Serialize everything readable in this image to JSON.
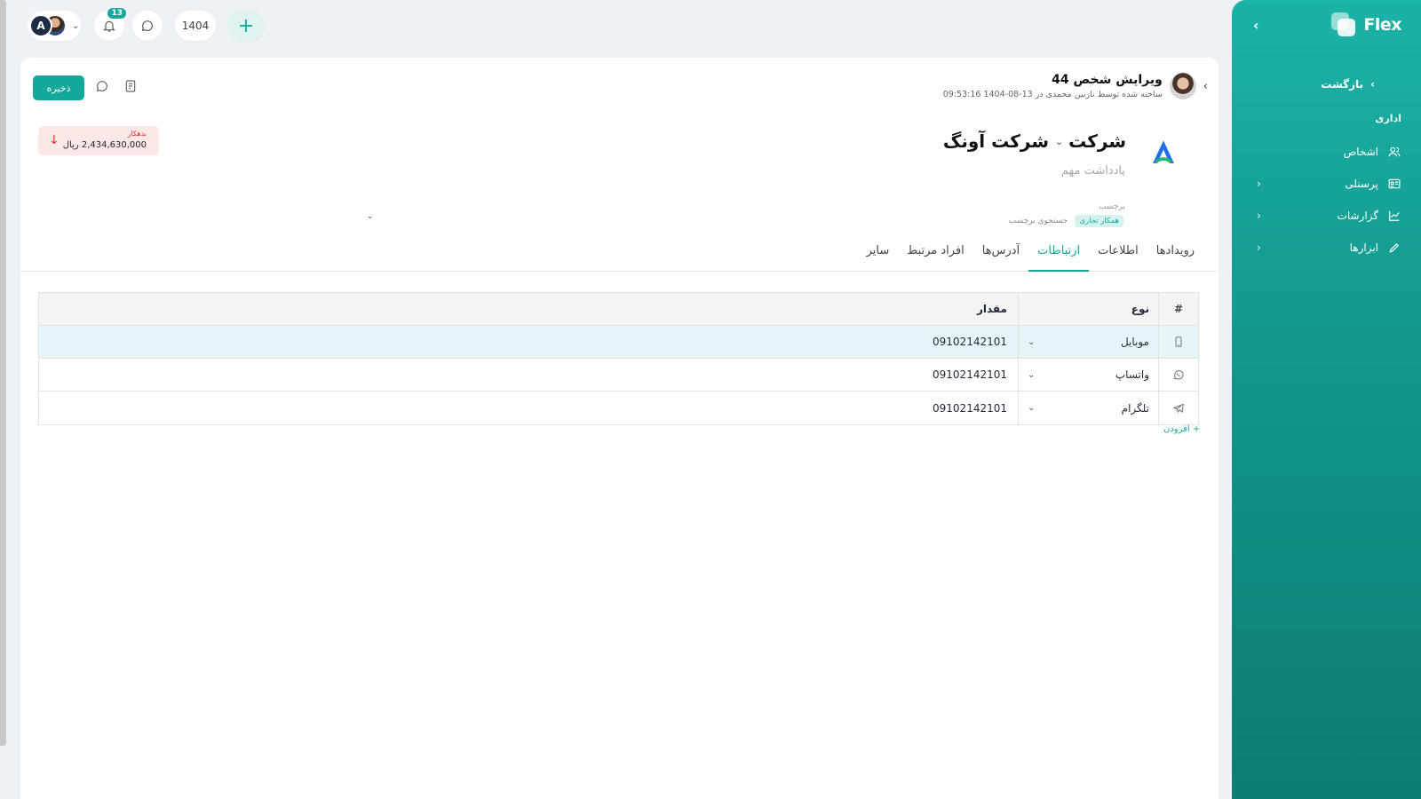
{
  "sidebar": {
    "brand": "Flex",
    "back_label": "بازگشت",
    "section_label": "اداری",
    "items": [
      {
        "label": "اشخاص",
        "icon": "users-icon"
      },
      {
        "label": "پرسنلی",
        "icon": "id-card-icon"
      },
      {
        "label": "گزارشات",
        "icon": "chart-line-icon"
      },
      {
        "label": "ابزارها",
        "icon": "pencil-icon"
      }
    ]
  },
  "topbar": {
    "avatar_initial": "A",
    "notification_count": "13",
    "year": "1404"
  },
  "header": {
    "title": "ویرایش شخص 44",
    "subtitle": "ساخته شده توسط نازنین محمدی در 13-08-1404 09:53:16",
    "save_label": "ذخیره"
  },
  "balance": {
    "label": "بدهکار",
    "value": "2,434,630,000 ریال",
    "status_color": "#e03131"
  },
  "entity": {
    "type": "شرکت",
    "name": "شرکت آونگ",
    "note_placeholder": "یادداشت مهم",
    "tag_label": "برچسب",
    "tags": [
      "همکار تجاری"
    ],
    "tag_search_placeholder": "جستجوی برچسب"
  },
  "tabs": [
    {
      "label": "رویدادها",
      "active": false
    },
    {
      "label": "اطلاعات",
      "active": false
    },
    {
      "label": "ارتباطات",
      "active": true
    },
    {
      "label": "آدرس‌ها",
      "active": false
    },
    {
      "label": "افراد مرتبط",
      "active": false
    },
    {
      "label": "سایر",
      "active": false
    }
  ],
  "contacts": {
    "columns": {
      "num": "#",
      "type": "نوع",
      "value": "مقدار"
    },
    "rows": [
      {
        "icon": "mobile-icon",
        "type": "موبایل",
        "value": "09102142101"
      },
      {
        "icon": "whatsapp-icon",
        "type": "واتساپ",
        "value": "09102142101"
      },
      {
        "icon": "telegram-icon",
        "type": "تلگرام",
        "value": "09102142101"
      }
    ],
    "add_label": "+ افزودن"
  },
  "colors": {
    "accent": "#14a89b",
    "sidebar_top": "#1bb3a6",
    "sidebar_bottom": "#0b7d73",
    "row_highlight": "#e6f6f8"
  }
}
